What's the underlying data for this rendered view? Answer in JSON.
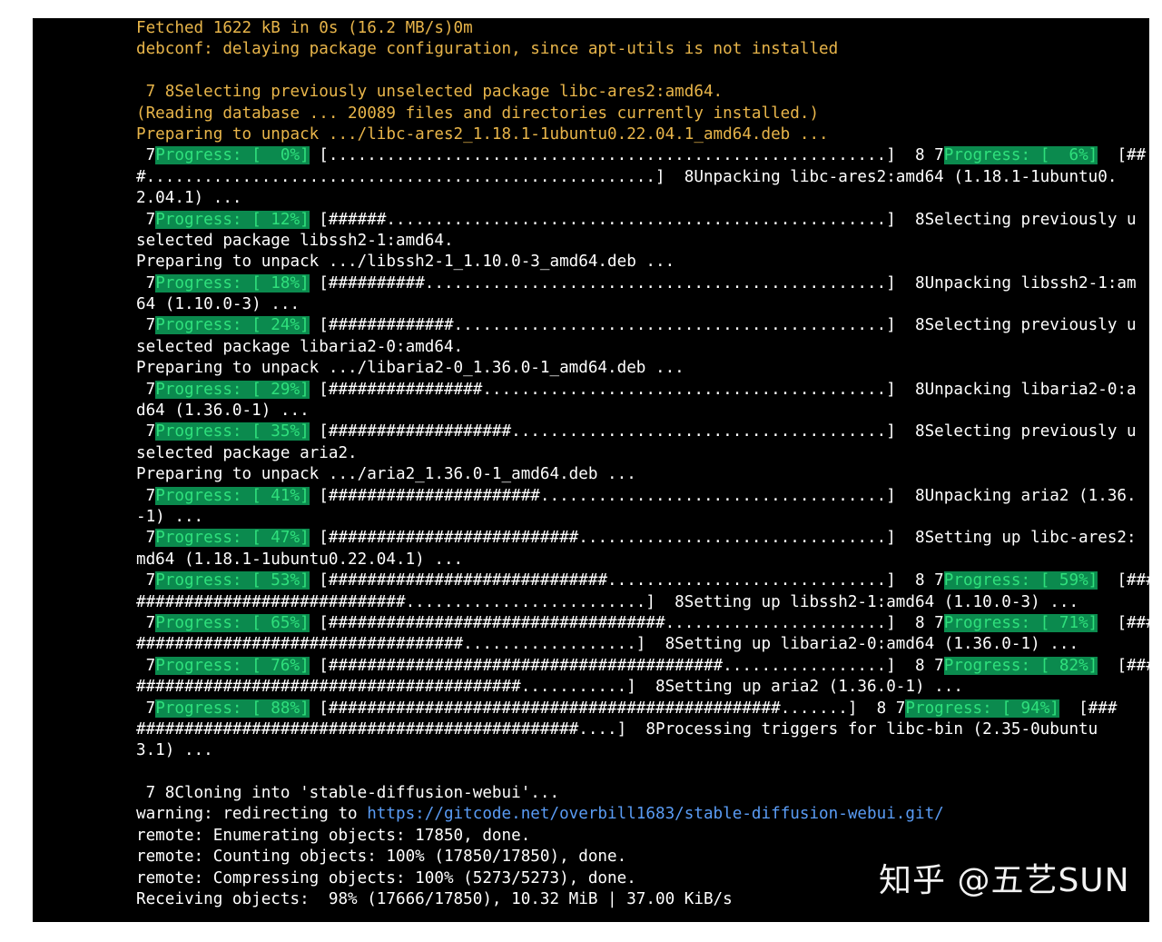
{
  "watermark": "知乎 @五艺SUN",
  "colors": {
    "terminal_bg": "#000000",
    "text": "#ffffff",
    "apt_output": "#e8b54a",
    "progress_bg": "#0b8a4e",
    "progress_text": "#2fe07c",
    "link": "#5a9cf5"
  },
  "lines": [
    {
      "style": "yellow",
      "segments": [
        {
          "text": "Fetched 1622 kB in 0s (16.2 MB/s)0m"
        }
      ]
    },
    {
      "style": "yellow",
      "segments": [
        {
          "text": "debconf: delaying package configuration, since apt-utils is not installed"
        }
      ]
    },
    {
      "style": "yellow",
      "segments": [
        {
          "text": ""
        }
      ]
    },
    {
      "style": "yellow",
      "segments": [
        {
          "text": " 7 8Selecting previously unselected package libc-ares2:amd64."
        }
      ]
    },
    {
      "style": "yellow",
      "segments": [
        {
          "text": "(Reading database ... 20089 files and directories currently installed.)"
        }
      ]
    },
    {
      "style": "yellow",
      "segments": [
        {
          "text": "Preparing to unpack .../libc-ares2_1.18.1-1ubuntu0.22.04.1_amd64.deb ..."
        }
      ]
    },
    {
      "style": "white",
      "segments": [
        {
          "text": " 7"
        },
        {
          "text": "Progress: [  0%]",
          "progress": true
        },
        {
          "text": " [..........................................................]  8 7"
        },
        {
          "text": "Progress: [  6%]",
          "progress": true
        },
        {
          "text": "  [##"
        }
      ]
    },
    {
      "style": "white",
      "segments": [
        {
          "text": "#.....................................................]  8Unpacking libc-ares2:amd64 (1.18.1-1ubuntu0."
        }
      ]
    },
    {
      "style": "white",
      "segments": [
        {
          "text": "2.04.1) ..."
        }
      ]
    },
    {
      "style": "white",
      "segments": [
        {
          "text": " 7"
        },
        {
          "text": "Progress: [ 12%]",
          "progress": true
        },
        {
          "text": " [######....................................................]  8Selecting previously u"
        }
      ]
    },
    {
      "style": "white",
      "segments": [
        {
          "text": "selected package libssh2-1:amd64."
        }
      ]
    },
    {
      "style": "white",
      "segments": [
        {
          "text": "Preparing to unpack .../libssh2-1_1.10.0-3_amd64.deb ..."
        }
      ]
    },
    {
      "style": "white",
      "segments": [
        {
          "text": " 7"
        },
        {
          "text": "Progress: [ 18%]",
          "progress": true
        },
        {
          "text": " [##########................................................]  8Unpacking libssh2-1:am"
        }
      ]
    },
    {
      "style": "white",
      "segments": [
        {
          "text": "64 (1.10.0-3) ..."
        }
      ]
    },
    {
      "style": "white",
      "segments": [
        {
          "text": " 7"
        },
        {
          "text": "Progress: [ 24%]",
          "progress": true
        },
        {
          "text": " [#############.............................................]  8Selecting previously u"
        }
      ]
    },
    {
      "style": "white",
      "segments": [
        {
          "text": "selected package libaria2-0:amd64."
        }
      ]
    },
    {
      "style": "white",
      "segments": [
        {
          "text": "Preparing to unpack .../libaria2-0_1.36.0-1_amd64.deb ..."
        }
      ]
    },
    {
      "style": "white",
      "segments": [
        {
          "text": " 7"
        },
        {
          "text": "Progress: [ 29%]",
          "progress": true
        },
        {
          "text": " [################..........................................]  8Unpacking libaria2-0:a"
        }
      ]
    },
    {
      "style": "white",
      "segments": [
        {
          "text": "d64 (1.36.0-1) ..."
        }
      ]
    },
    {
      "style": "white",
      "segments": [
        {
          "text": " 7"
        },
        {
          "text": "Progress: [ 35%]",
          "progress": true
        },
        {
          "text": " [###################.......................................]  8Selecting previously u"
        }
      ]
    },
    {
      "style": "white",
      "segments": [
        {
          "text": "selected package aria2."
        }
      ]
    },
    {
      "style": "white",
      "segments": [
        {
          "text": "Preparing to unpack .../aria2_1.36.0-1_amd64.deb ..."
        }
      ]
    },
    {
      "style": "white",
      "segments": [
        {
          "text": " 7"
        },
        {
          "text": "Progress: [ 41%]",
          "progress": true
        },
        {
          "text": " [######################....................................]  8Unpacking aria2 (1.36."
        }
      ]
    },
    {
      "style": "white",
      "segments": [
        {
          "text": "-1) ..."
        }
      ]
    },
    {
      "style": "white",
      "segments": [
        {
          "text": " 7"
        },
        {
          "text": "Progress: [ 47%]",
          "progress": true
        },
        {
          "text": " [##########################................................]  8Setting up libc-ares2:"
        }
      ]
    },
    {
      "style": "white",
      "segments": [
        {
          "text": "md64 (1.18.1-1ubuntu0.22.04.1) ..."
        }
      ]
    },
    {
      "style": "white",
      "segments": [
        {
          "text": " 7"
        },
        {
          "text": "Progress: [ 53%]",
          "progress": true
        },
        {
          "text": " [#############################.............................]  8 7"
        },
        {
          "text": "Progress: [ 59%]",
          "progress": true
        },
        {
          "text": "  [###"
        }
      ]
    },
    {
      "style": "white",
      "segments": [
        {
          "text": "############################.........................]  8Setting up libssh2-1:amd64 (1.10.0-3) ..."
        }
      ]
    },
    {
      "style": "white",
      "segments": [
        {
          "text": " 7"
        },
        {
          "text": "Progress: [ 65%]",
          "progress": true
        },
        {
          "text": " [###################################.......................]  8 7"
        },
        {
          "text": "Progress: [ 71%]",
          "progress": true
        },
        {
          "text": "  [###"
        }
      ]
    },
    {
      "style": "white",
      "segments": [
        {
          "text": "##################################..................]  8Setting up libaria2-0:amd64 (1.36.0-1) ..."
        }
      ]
    },
    {
      "style": "white",
      "segments": [
        {
          "text": " 7"
        },
        {
          "text": "Progress: [ 76%]",
          "progress": true
        },
        {
          "text": " [#########################################.................]  8 7"
        },
        {
          "text": "Progress: [ 82%]",
          "progress": true
        },
        {
          "text": "  [###"
        }
      ]
    },
    {
      "style": "white",
      "segments": [
        {
          "text": "########################################...........]  8Setting up aria2 (1.36.0-1) ..."
        }
      ]
    },
    {
      "style": "white",
      "segments": [
        {
          "text": " 7"
        },
        {
          "text": "Progress: [ 88%]",
          "progress": true
        },
        {
          "text": " [###############################################.......]  8 7"
        },
        {
          "text": "Progress: [ 94%]",
          "progress": true
        },
        {
          "text": "  [###"
        }
      ]
    },
    {
      "style": "white",
      "segments": [
        {
          "text": "##############################################....]  8Processing triggers for libc-bin (2.35-0ubuntu"
        }
      ]
    },
    {
      "style": "white",
      "segments": [
        {
          "text": "3.1) ..."
        }
      ]
    },
    {
      "style": "white",
      "segments": [
        {
          "text": ""
        }
      ]
    },
    {
      "style": "white",
      "segments": [
        {
          "text": " 7 8Cloning into 'stable-diffusion-webui'..."
        }
      ]
    },
    {
      "style": "white",
      "segments": [
        {
          "text": "warning: redirecting to "
        },
        {
          "text": "https://gitcode.net/overbill1683/stable-diffusion-webui.git/",
          "link": true
        }
      ]
    },
    {
      "style": "white",
      "segments": [
        {
          "text": "remote: Enumerating objects: 17850, done."
        }
      ]
    },
    {
      "style": "white",
      "segments": [
        {
          "text": "remote: Counting objects: 100% (17850/17850), done."
        }
      ]
    },
    {
      "style": "white",
      "segments": [
        {
          "text": "remote: Compressing objects: 100% (5273/5273), done."
        }
      ]
    },
    {
      "style": "white",
      "segments": [
        {
          "text": "Receiving objects:  98% (17666/17850), 10.32 MiB | 37.00 KiB/s"
        }
      ]
    }
  ]
}
